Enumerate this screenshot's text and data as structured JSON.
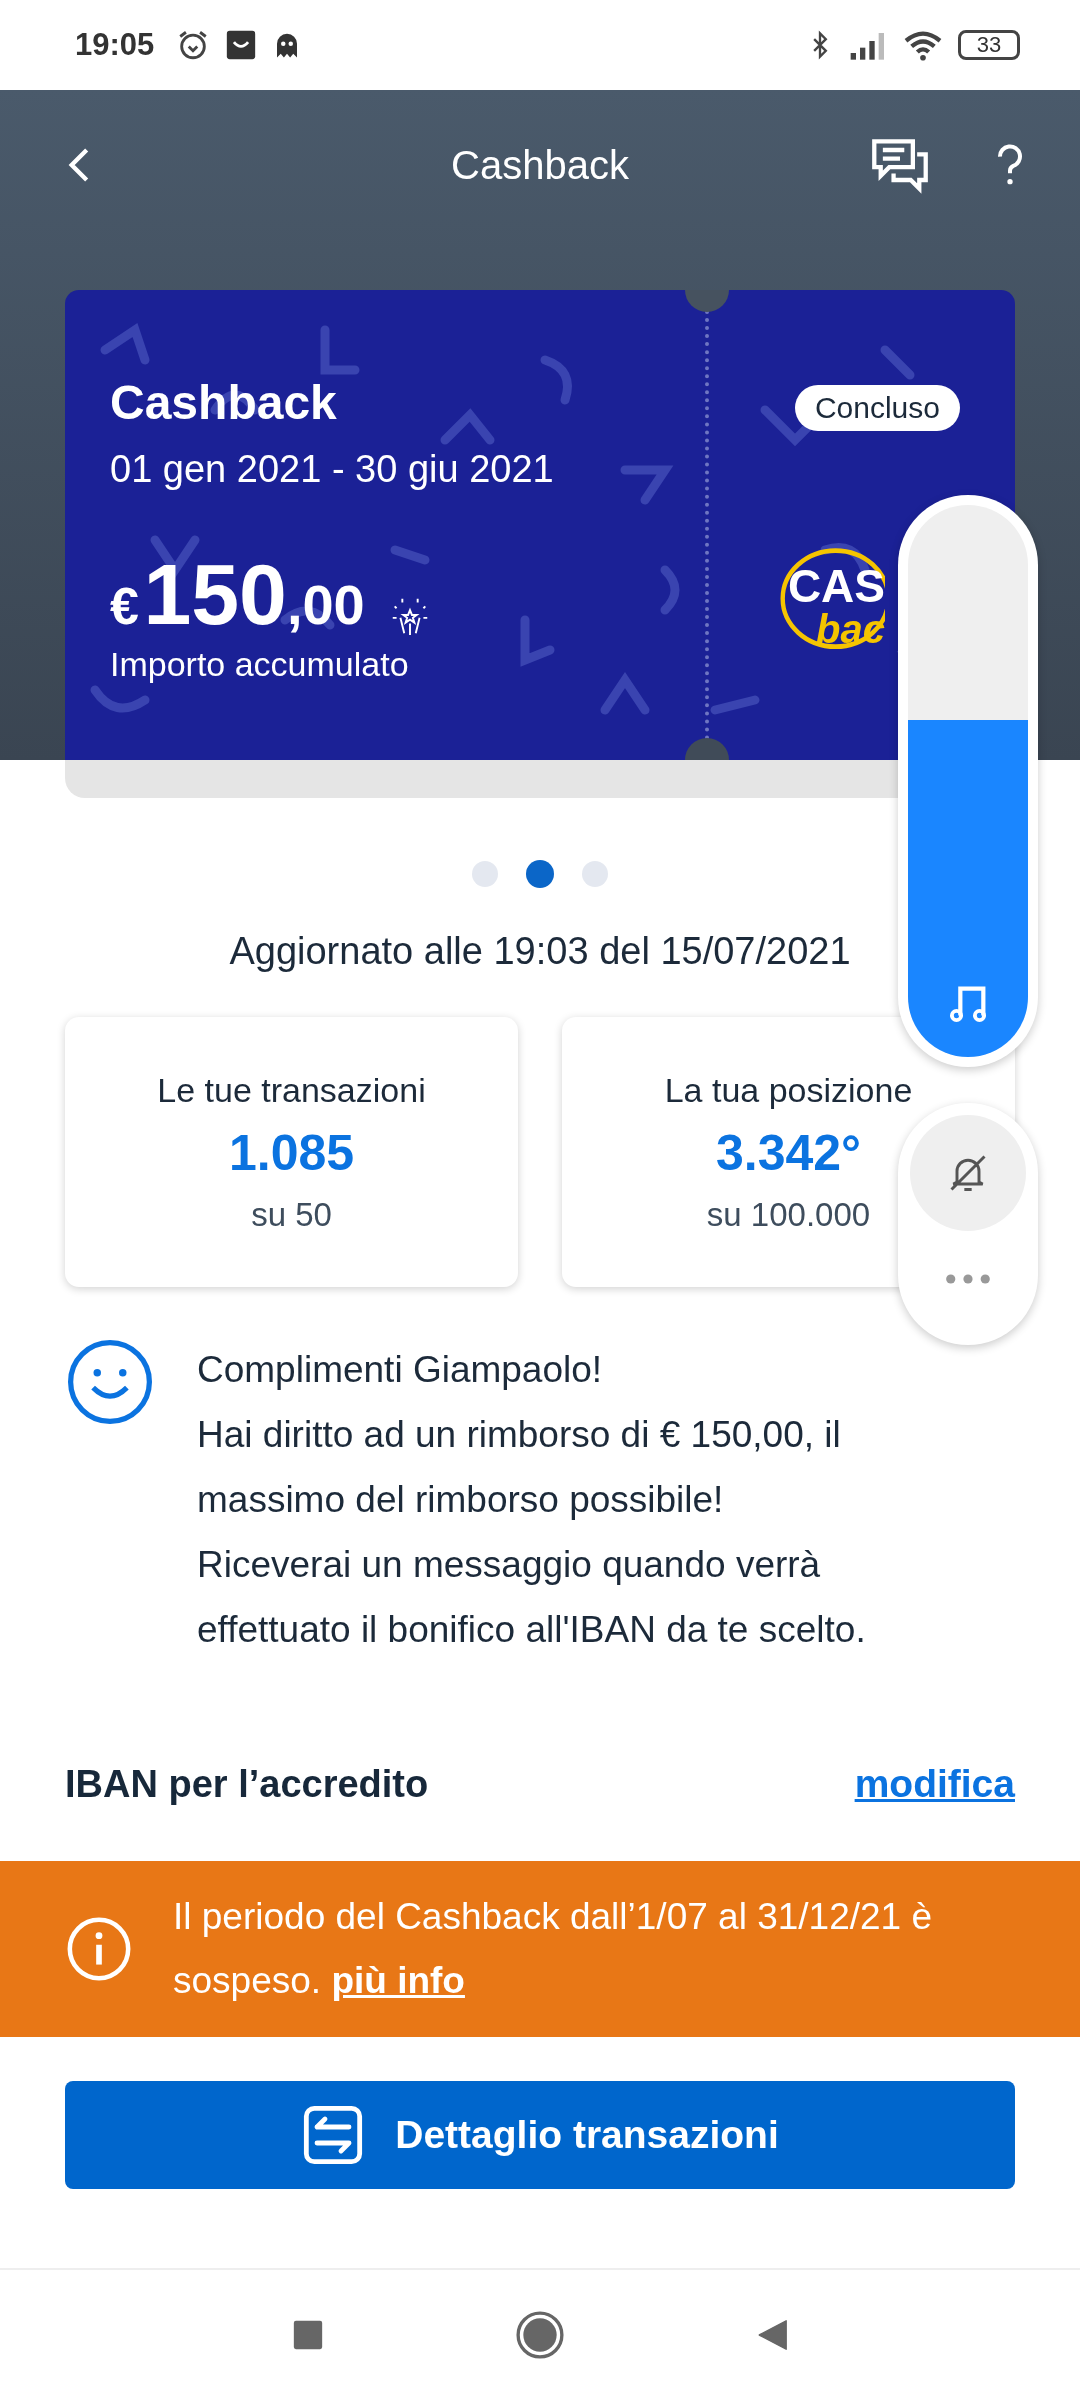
{
  "status_bar": {
    "time": "19:05",
    "battery": "33"
  },
  "header": {
    "title": "Cashback"
  },
  "card": {
    "title": "Cashback",
    "period": "01 gen 2021 - 30 giu 2021",
    "badge": "Concluso",
    "currency": "€",
    "amount_int": "150",
    "amount_dec": ",00",
    "amount_label": "Importo accumulato",
    "logo_line1": "CAS",
    "logo_line2": "bac"
  },
  "pager": [
    {
      "selected": false
    },
    {
      "selected": true
    },
    {
      "selected": false
    }
  ],
  "updated": "Aggiornato alle 19:03 del 15/07/2021",
  "stats": [
    {
      "title": "Le tue transazioni",
      "value": "1.085",
      "sub": "su 50"
    },
    {
      "title": "La tua posizione",
      "value": "3.342°",
      "sub": "su 100.000"
    }
  ],
  "message": {
    "lines": [
      "Complimenti Giampaolo!",
      "Hai diritto ad un rimborso di € 150,00, il massimo del rimborso possibile!",
      "Riceverai un messaggio quando verrà effettuato il bonifico all'IBAN da te scelto."
    ]
  },
  "iban": {
    "label": "IBAN per l’accredito",
    "link": "modifica"
  },
  "notice": {
    "text": "Il periodo del Cashback dall’1/07 al 31/12/21 è sospeso.",
    "link": "più info"
  },
  "primary_button": {
    "label": "Dettaglio transazioni"
  },
  "volume_panel": {
    "level": 0.61
  }
}
